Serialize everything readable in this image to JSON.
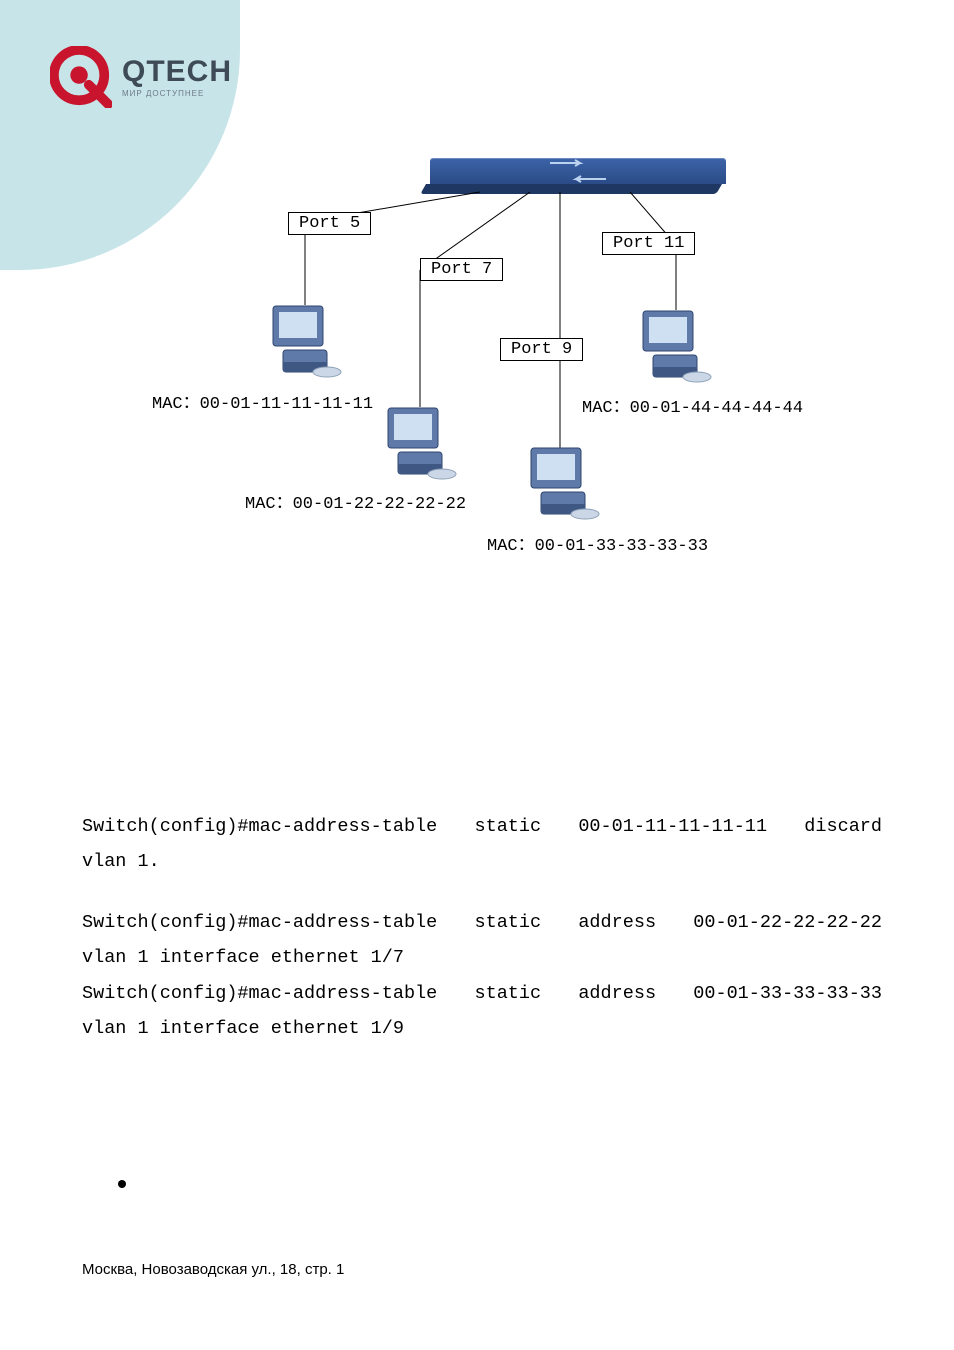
{
  "logo": {
    "name": "QTECH",
    "tagline": "МИР ДОСТУПНЕЕ"
  },
  "diagram": {
    "ports": {
      "p5": "Port 5",
      "p7": "Port 7",
      "p9": "Port 9",
      "p11": "Port 11"
    },
    "macs": {
      "pc1_prefix": "MAC：",
      "pc1": "00-01-11-11-11-11",
      "pc2_prefix": "MAC：",
      "pc2": "00-01-22-22-22-22",
      "pc3_prefix": "MAC：",
      "pc3": "00-01-33-33-33-33",
      "pc4_prefix": "MAC：",
      "pc4": "00-01-44-44-44-44"
    }
  },
  "code": {
    "l1a": "Switch(config)#mac-address-table",
    "l1b": "static",
    "l1c": "00-01-11-11-11-11",
    "l1d": "discard",
    "l2": "vlan 1.",
    "l3a": "Switch(config)#mac-address-table",
    "l3b": "static",
    "l3c": "address",
    "l3d": "00-01-22-22-22-22",
    "l4": "vlan 1 interface ethernet 1/7",
    "l5a": "Switch(config)#mac-address-table",
    "l5b": "static",
    "l5c": "address",
    "l5d": "00-01-33-33-33-33",
    "l6": "vlan 1 interface ethernet 1/9"
  },
  "footer": "Москва, Новозаводская ул., 18, стр. 1"
}
